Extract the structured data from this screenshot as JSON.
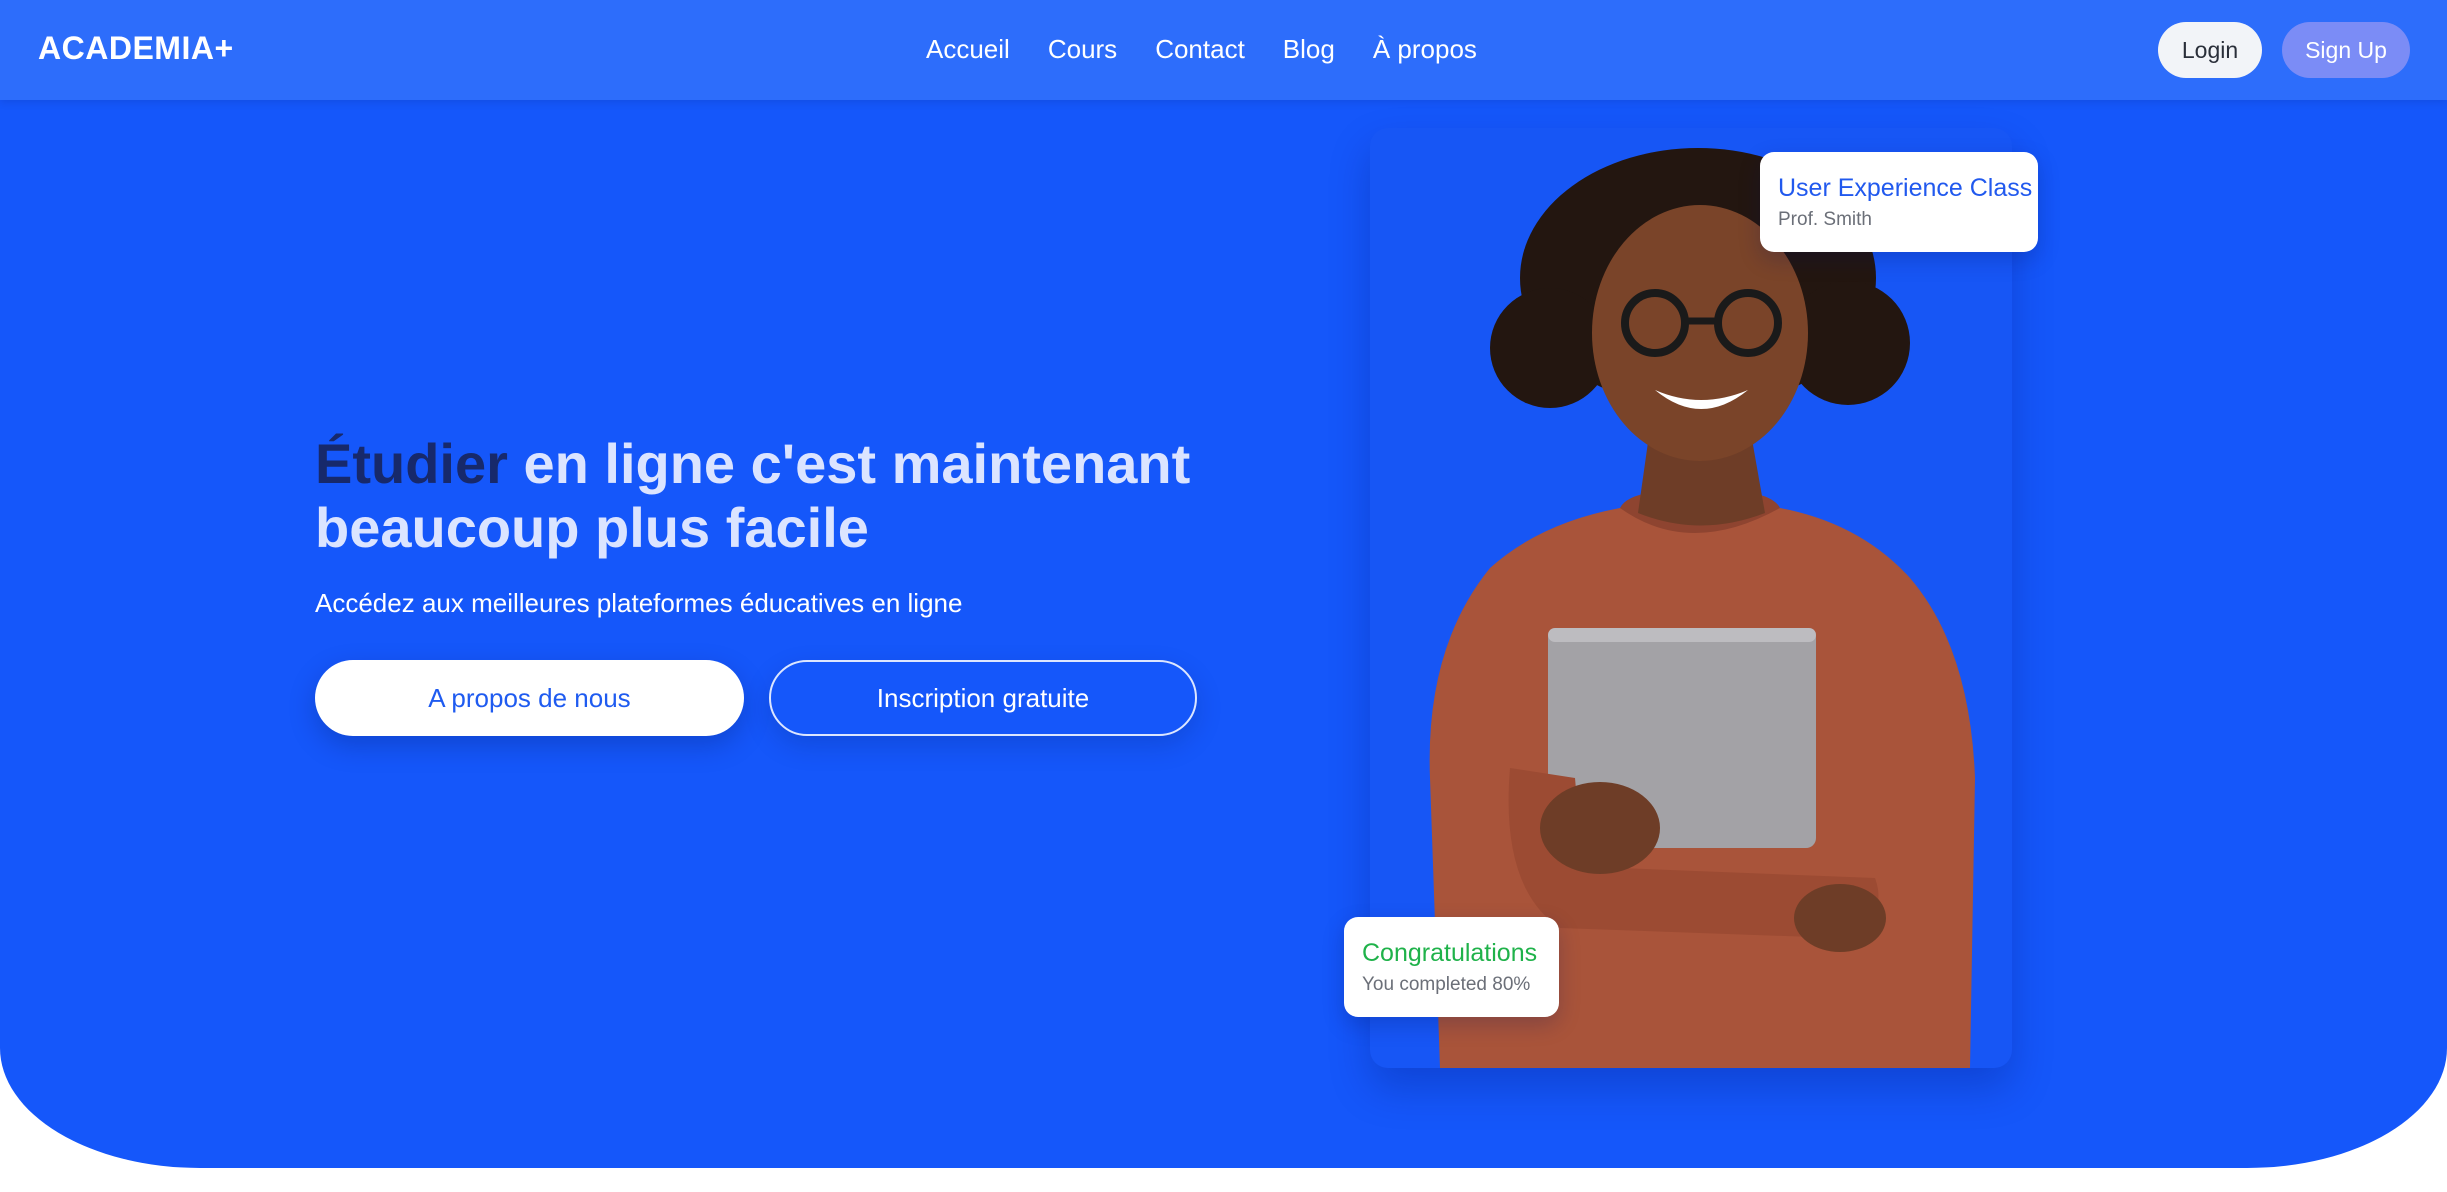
{
  "navbar": {
    "brand": "ACADEMIA+",
    "links": [
      {
        "label": "Accueil"
      },
      {
        "label": "Cours"
      },
      {
        "label": "Contact"
      },
      {
        "label": "Blog"
      },
      {
        "label": "À propos"
      }
    ],
    "login_label": "Login",
    "signup_label": "Sign Up"
  },
  "hero": {
    "headline_accent": "Étudier",
    "headline_rest": " en ligne c'est maintenant beaucoup plus facile",
    "subtitle": "Accédez aux meilleures plateformes éducatives en ligne",
    "primary_button": "A propos de nous",
    "secondary_button": "Inscription gratuite"
  },
  "cards": {
    "class_card": {
      "title": "User Experience Class",
      "subtitle": "Prof. Smith"
    },
    "progress_card": {
      "title": "Congratulations",
      "subtitle": "You completed 80%"
    }
  },
  "colors": {
    "hero_background": "#1557fa",
    "navbar_background": "#2d6dfb",
    "headline_accent": "#17296b",
    "signup_button": "#7b8cf6",
    "congrats_green": "#1fb24a"
  }
}
